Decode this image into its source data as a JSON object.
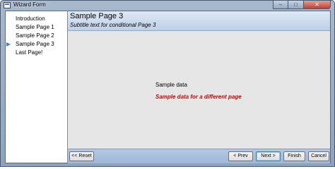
{
  "window": {
    "title": "Wizard Form"
  },
  "sidebar": {
    "items": [
      {
        "label": "Introduction",
        "current": false
      },
      {
        "label": "Sample Page 1",
        "current": false
      },
      {
        "label": "Sample Page 2",
        "current": false
      },
      {
        "label": "Sample Page 3",
        "current": true
      },
      {
        "label": "Last Page!",
        "current": false
      }
    ]
  },
  "page": {
    "title": "Sample Page 3",
    "subtitle": "Subtitle text for conditional Page 3",
    "sample_text": "Sample data",
    "sample_text_alt": "Sample data for a different page"
  },
  "footer": {
    "reset_label": "<< Reset",
    "prev_label": "< Prev",
    "next_label": "Next >",
    "finish_label": "Finish",
    "cancel_label": "Cancel"
  },
  "colors": {
    "accent_arrow": "#3b7fd6",
    "alt_text": "#cc0000",
    "header_bg": "#bcd0e8",
    "footer_bg": "#9fb8d8"
  },
  "icons": {
    "current_step": "triangle-right-icon",
    "app": "window-icon"
  }
}
